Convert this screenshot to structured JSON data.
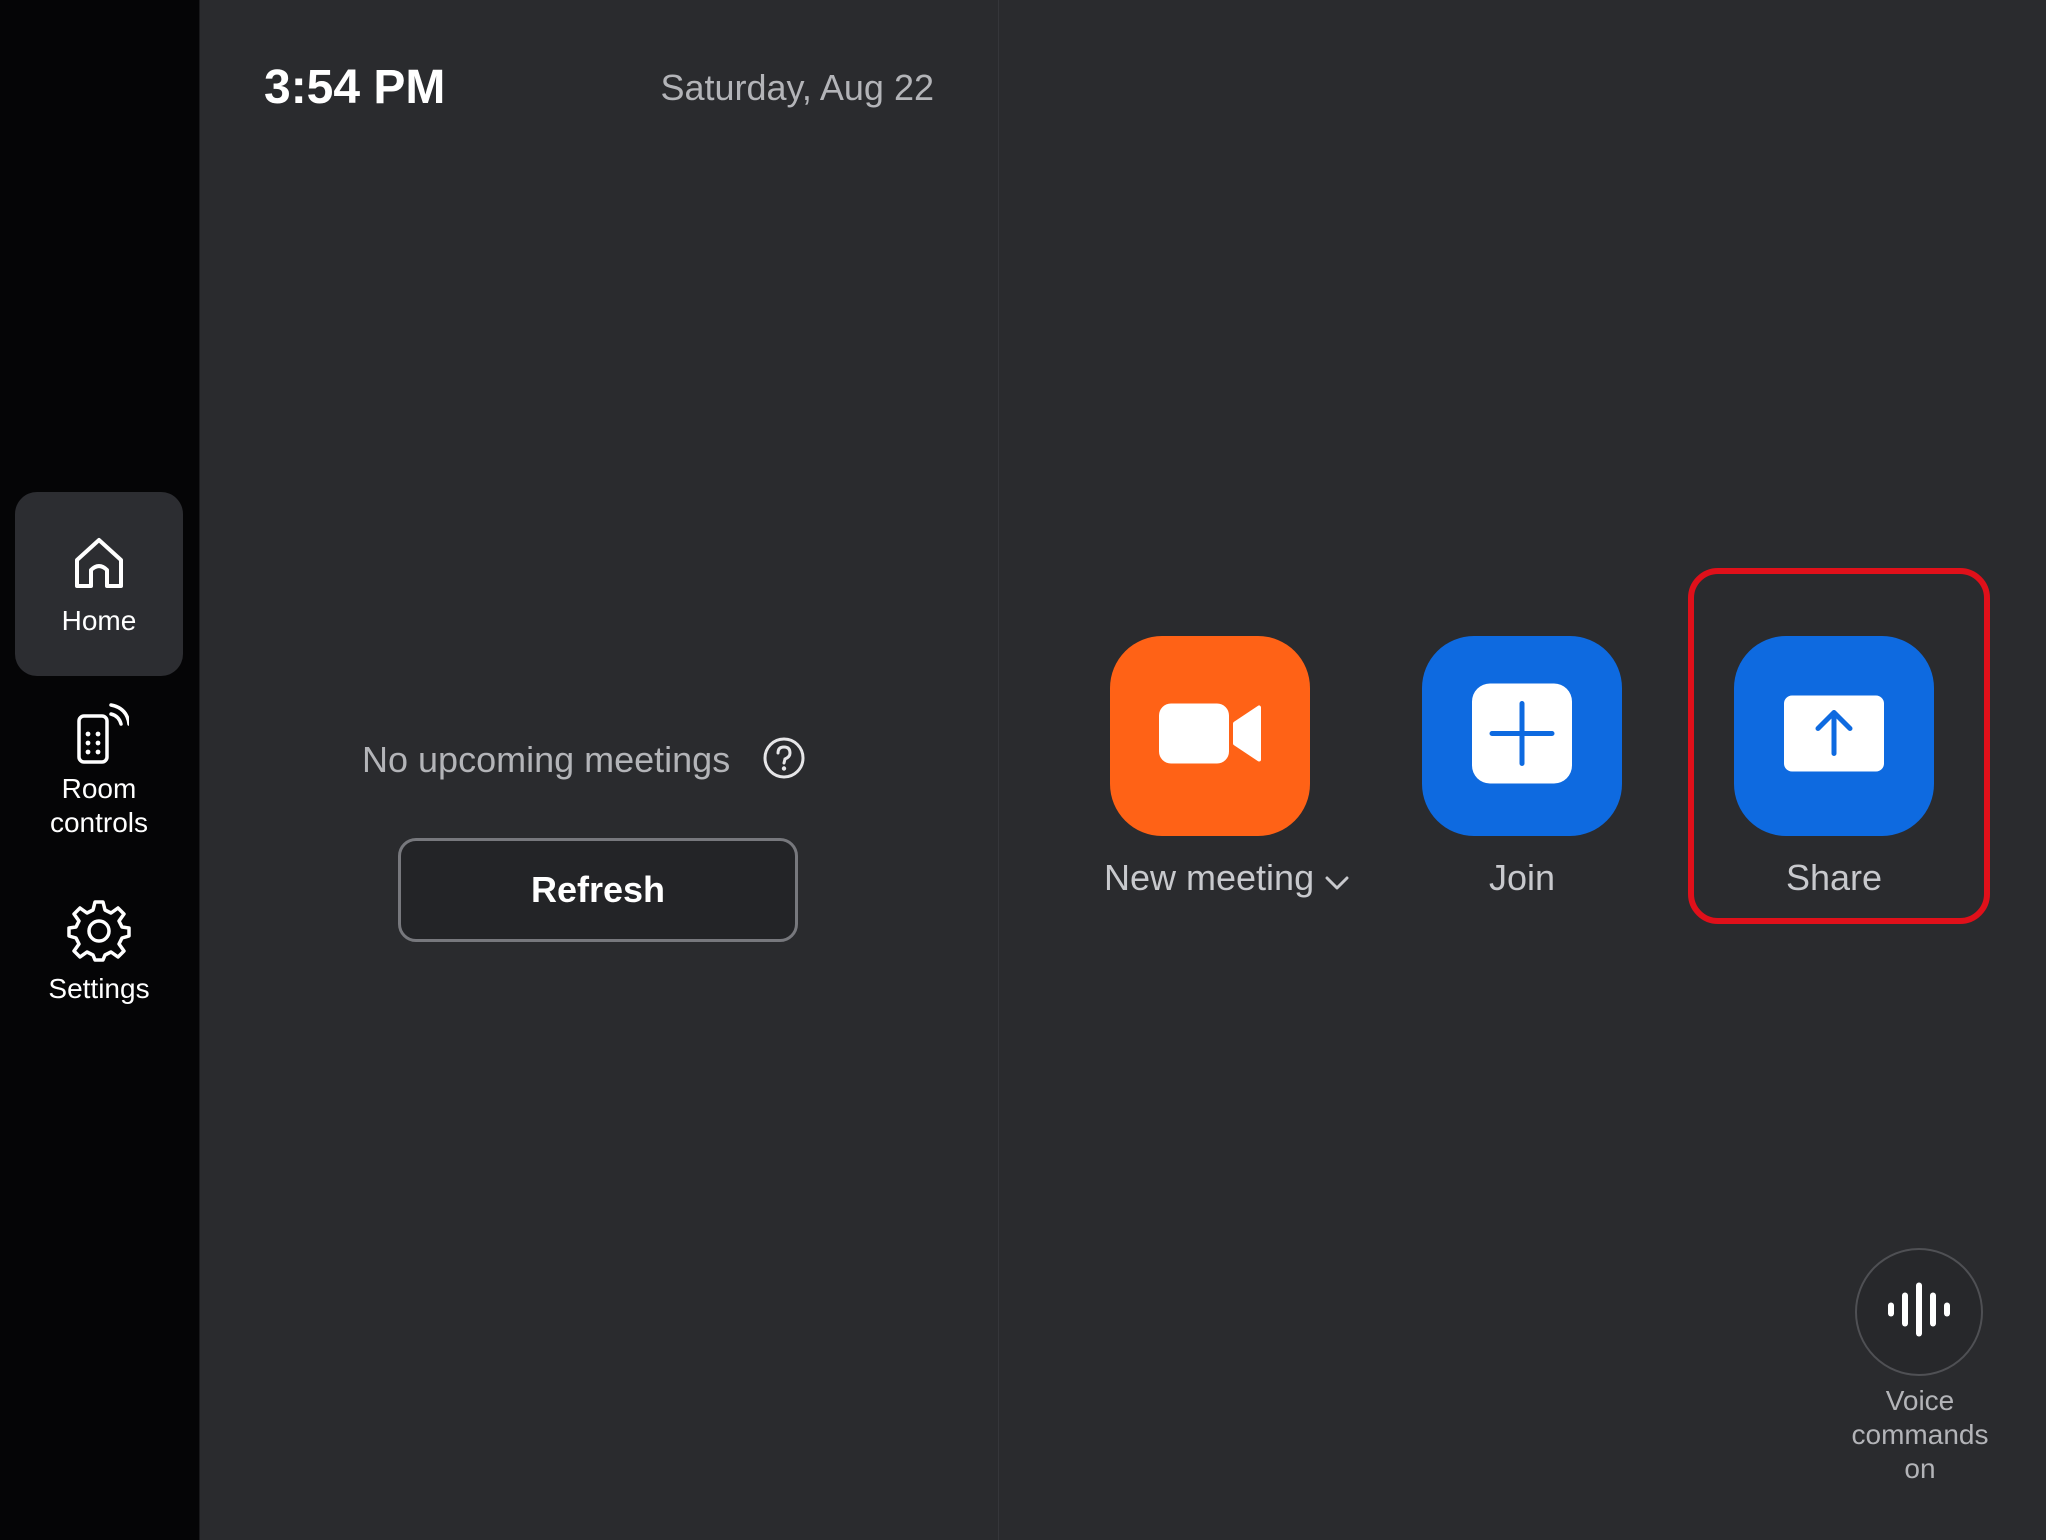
{
  "sidebar": {
    "items": [
      {
        "label": "Home",
        "icon": "home-icon",
        "active": true
      },
      {
        "label": "Room\ncontrols",
        "icon": "room-controls-icon",
        "active": false
      },
      {
        "label": "Settings",
        "icon": "gear-icon",
        "active": false
      }
    ]
  },
  "header": {
    "time": "3:54 PM",
    "date": "Saturday, Aug 22"
  },
  "meetings": {
    "empty_text": "No upcoming meetings",
    "help_icon": "help-icon",
    "refresh_label": "Refresh"
  },
  "actions": [
    {
      "label": "New meeting",
      "icon": "video-camera-icon",
      "color": "#ff6216",
      "has_dropdown": true
    },
    {
      "label": "Join",
      "icon": "plus-icon",
      "color": "#0e6ae0"
    },
    {
      "label": "Share",
      "icon": "share-screen-icon",
      "color": "#0e6ae0"
    }
  ],
  "voice": {
    "label": "Voice\ncommands\non",
    "icon": "voice-waveform-icon"
  },
  "colors": {
    "background": "#2a2b2e",
    "sidebar": "#050506",
    "accent_orange": "#ff6216",
    "accent_blue": "#0e6ae0",
    "highlight": "#e0101a"
  }
}
